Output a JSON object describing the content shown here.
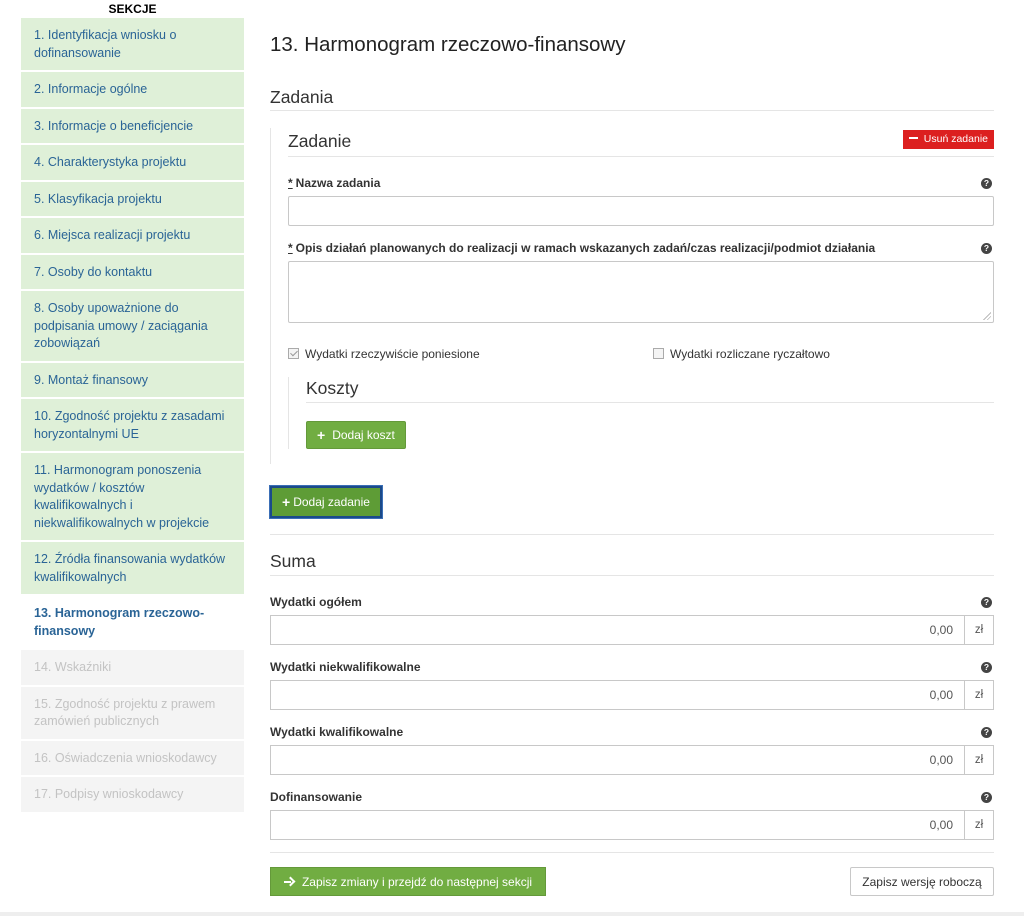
{
  "sidebar": {
    "title": "SEKCJE",
    "items": [
      {
        "label": "1. Identyfikacja wniosku o dofinansowanie",
        "state": "done"
      },
      {
        "label": "2. Informacje ogólne",
        "state": "done"
      },
      {
        "label": "3. Informacje o beneficjencie",
        "state": "done"
      },
      {
        "label": "4. Charakterystyka projektu",
        "state": "done"
      },
      {
        "label": "5. Klasyfikacja projektu",
        "state": "done"
      },
      {
        "label": "6. Miejsca realizacji projektu",
        "state": "done"
      },
      {
        "label": "7. Osoby do kontaktu",
        "state": "done"
      },
      {
        "label": "8. Osoby upoważnione do podpisania umowy / zaciągania zobowiązań",
        "state": "done"
      },
      {
        "label": "9. Montaż finansowy",
        "state": "done"
      },
      {
        "label": "10. Zgodność projektu z zasadami horyzontalnymi UE",
        "state": "done"
      },
      {
        "label": "11. Harmonogram ponoszenia wydatków / kosztów kwalifikowalnych i niekwalifikowalnych w projekcie",
        "state": "done"
      },
      {
        "label": "12. Źródła finansowania wydatków kwalifikowalnych",
        "state": "done"
      },
      {
        "label": "13. Harmonogram rzeczowo-finansowy",
        "state": "active"
      },
      {
        "label": "14. Wskaźniki",
        "state": "disabled"
      },
      {
        "label": "15. Zgodność projektu z prawem zamówień publicznych",
        "state": "disabled"
      },
      {
        "label": "16. Oświadczenia wnioskodawcy",
        "state": "disabled"
      },
      {
        "label": "17. Podpisy wnioskodawcy",
        "state": "disabled"
      }
    ]
  },
  "main": {
    "title": "13. Harmonogram rzeczowo-finansowy",
    "zadania_heading": "Zadania",
    "task": {
      "heading": "Zadanie",
      "remove_label": "Usuń zadanie",
      "name_label": "Nazwa zadania",
      "name_value": "",
      "desc_label": "Opis działań planowanych do realizacji w ramach wskazanych zadań/czas realizacji/podmiot działania",
      "desc_value": "",
      "required_mark": "*",
      "checkbox_actual": {
        "label": "Wydatki rzeczywiście poniesione",
        "checked": true
      },
      "checkbox_lump": {
        "label": "Wydatki rozliczane ryczałtowo",
        "checked": false
      },
      "costs_heading": "Koszty",
      "add_cost_label": "Dodaj koszt"
    },
    "add_task_label": "Dodaj zadanie",
    "suma": {
      "heading": "Suma",
      "currency": "zł",
      "rows": [
        {
          "label": "Wydatki ogółem",
          "value": "0,00"
        },
        {
          "label": "Wydatki niekwalifikowalne",
          "value": "0,00"
        },
        {
          "label": "Wydatki kwalifikowalne",
          "value": "0,00"
        },
        {
          "label": "Dofinansowanie",
          "value": "0,00"
        }
      ]
    },
    "save_next_label": "Zapisz zmiany i przejdź do następnej sekcji",
    "save_draft_label": "Zapisz wersję roboczą",
    "help_glyph": "?",
    "plus_glyph": "+"
  },
  "colors": {
    "sidebar_done_bg": "#dff0d8",
    "sidebar_link": "#2a6496",
    "sidebar_disabled_text": "#c3c3c3",
    "button_green": "#71ad42",
    "button_red": "#dc1f1f",
    "focus_border": "#1b4a8a"
  },
  "icons": {
    "remove": "minus-icon",
    "help": "question-circle-icon",
    "add": "plus-icon",
    "next": "arrow-right-icon",
    "checkbox": "checkbox-icon"
  }
}
